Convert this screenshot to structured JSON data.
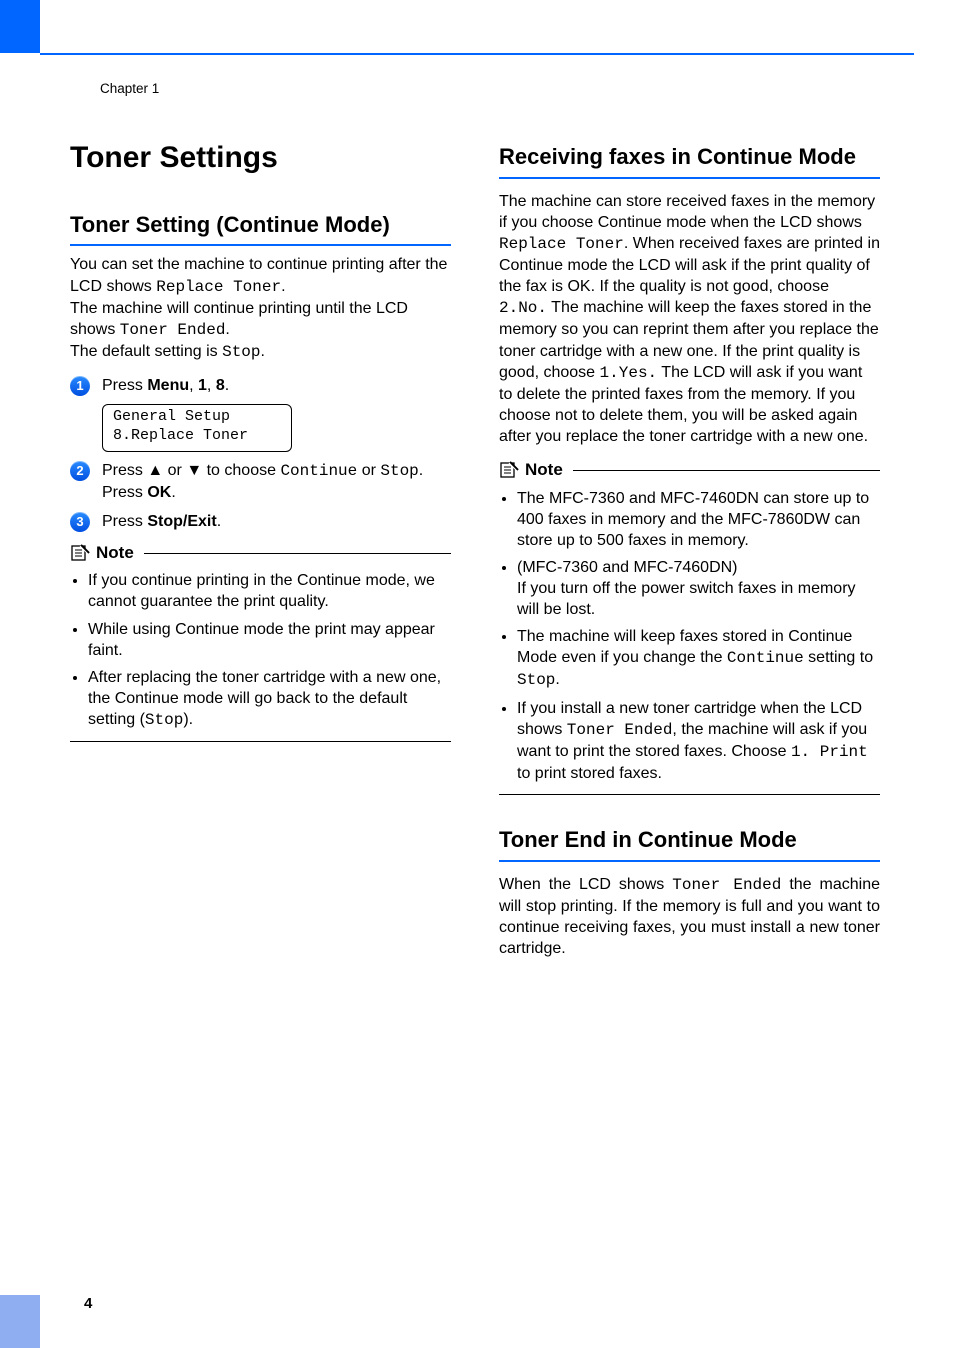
{
  "header": {
    "chapter": "Chapter 1"
  },
  "page_number": "4",
  "left": {
    "title": "Toner Settings",
    "subtitle": "Toner Setting (Continue Mode)",
    "intro": {
      "p1a": "You can set the machine to continue printing after the LCD shows ",
      "p1_code": "Replace Toner",
      "p1b": ".",
      "p2a": "The machine will continue printing until the LCD shows ",
      "p2_code": "Toner Ended",
      "p2b": ".",
      "p3a": "The default setting is ",
      "p3_code": "Stop",
      "p3b": "."
    },
    "steps": {
      "s1_press": "Press ",
      "s1_menu": "Menu",
      "s1_sep1": ", ",
      "s1_k1": "1",
      "s1_sep2": ", ",
      "s1_k2": "8",
      "s1_end": ".",
      "lcd_l1": "General Setup",
      "lcd_l2": "8.Replace Toner",
      "s2_a": "Press ",
      "s2_up": "▲",
      "s2_or": " or ",
      "s2_down": "▼",
      "s2_b": " to choose ",
      "s2_opt1": "Continue",
      "s2_c": " or ",
      "s2_opt2": "Stop",
      "s2_d": ".",
      "s2_e": "Press ",
      "s2_ok": "OK",
      "s2_f": ".",
      "s3_a": "Press ",
      "s3_b": "Stop/Exit",
      "s3_c": "."
    },
    "note_label": "Note",
    "notes": {
      "n1": "If you continue printing in the Continue mode, we cannot guarantee the print quality.",
      "n2": "While using Continue mode the print may appear faint.",
      "n3a": "After replacing the toner cartridge with a new one, the Continue mode will go back to the default setting (",
      "n3_code": "Stop",
      "n3b": ")."
    }
  },
  "right": {
    "sec1": {
      "title": "Receiving faxes in Continue Mode",
      "p1a": "The machine can store received faxes in the memory if you choose Continue mode when the LCD shows ",
      "p1_code1": "Replace Toner",
      "p1b": ". When received faxes are printed in Continue mode the LCD will ask if the print quality of the fax is OK. If the quality is not good, choose ",
      "p1_code2": "2.No.",
      "p1c": " The machine will keep the faxes stored in the memory so you can reprint them after you replace the toner cartridge with a new one. If the print quality is good, choose ",
      "p1_code3": "1.Yes.",
      "p1d": " The LCD will ask if you want to delete the printed faxes from the memory. If you choose not to delete them, you will be asked again after you replace the toner cartridge with a new one.",
      "note_label": "Note",
      "notes": {
        "n1": "The MFC-7360 and MFC-7460DN can store up to 400 faxes in memory and the MFC-7860DW can store up to 500 faxes in memory.",
        "n2a": "(MFC-7360 and MFC-7460DN)",
        "n2b": "If you turn off the power switch faxes in memory will be lost.",
        "n3a": "The machine will keep faxes stored in Continue Mode even if you change the ",
        "n3_code1": "Continue",
        "n3b": " setting to ",
        "n3_code2": "Stop",
        "n3c": ".",
        "n4a": "If you install a new toner cartridge when the LCD shows ",
        "n4_code1": "Toner Ended",
        "n4b": ", the machine will ask if you want to print the stored faxes. Choose ",
        "n4_code2": "1. Print",
        "n4c": " to print stored faxes."
      }
    },
    "sec2": {
      "title": "Toner End in Continue Mode",
      "p1a": "When the LCD shows ",
      "p1_code": "Toner Ended",
      "p1b": " the machine will stop printing. If the memory is full and you want to continue receiving faxes, you must install a new toner cartridge."
    }
  }
}
